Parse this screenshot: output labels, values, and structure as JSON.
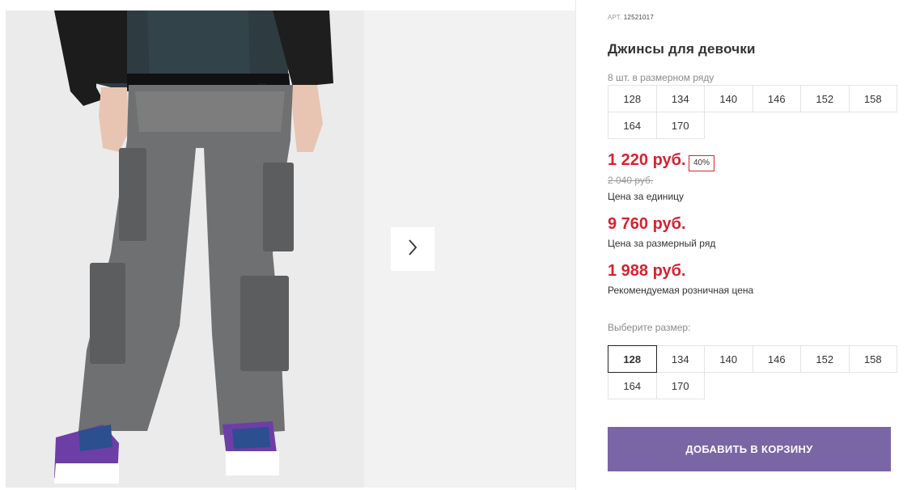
{
  "product": {
    "art_label": "АРТ.",
    "art_value": "12521017",
    "title": "Джинсы для девочки",
    "pack_label": "8 шт. в размерном ряду",
    "pack_sizes": [
      "128",
      "134",
      "140",
      "146",
      "152",
      "158",
      "164",
      "170"
    ],
    "price_current": "1 220 руб.",
    "discount": "40%",
    "price_old": "2 040 руб.",
    "unit_price_label": "Цена за единицу",
    "pack_price": "9 760 руб.",
    "pack_price_label": "Цена за размерный ряд",
    "rrp_price": "1 988 руб.",
    "rrp_label": "Рекомендуемая розничная цена",
    "choose_size_label": "Выберите размер:",
    "sizes": [
      "128",
      "134",
      "140",
      "146",
      "152",
      "158",
      "164",
      "170"
    ],
    "selected_size": "128",
    "add_to_cart": "ДОБАВИТЬ В КОРЗИНУ"
  },
  "gallery": {
    "next_icon": "chevron-right-icon"
  },
  "colors": {
    "accent_red": "#d62231",
    "button_purple": "#7a65a5"
  }
}
